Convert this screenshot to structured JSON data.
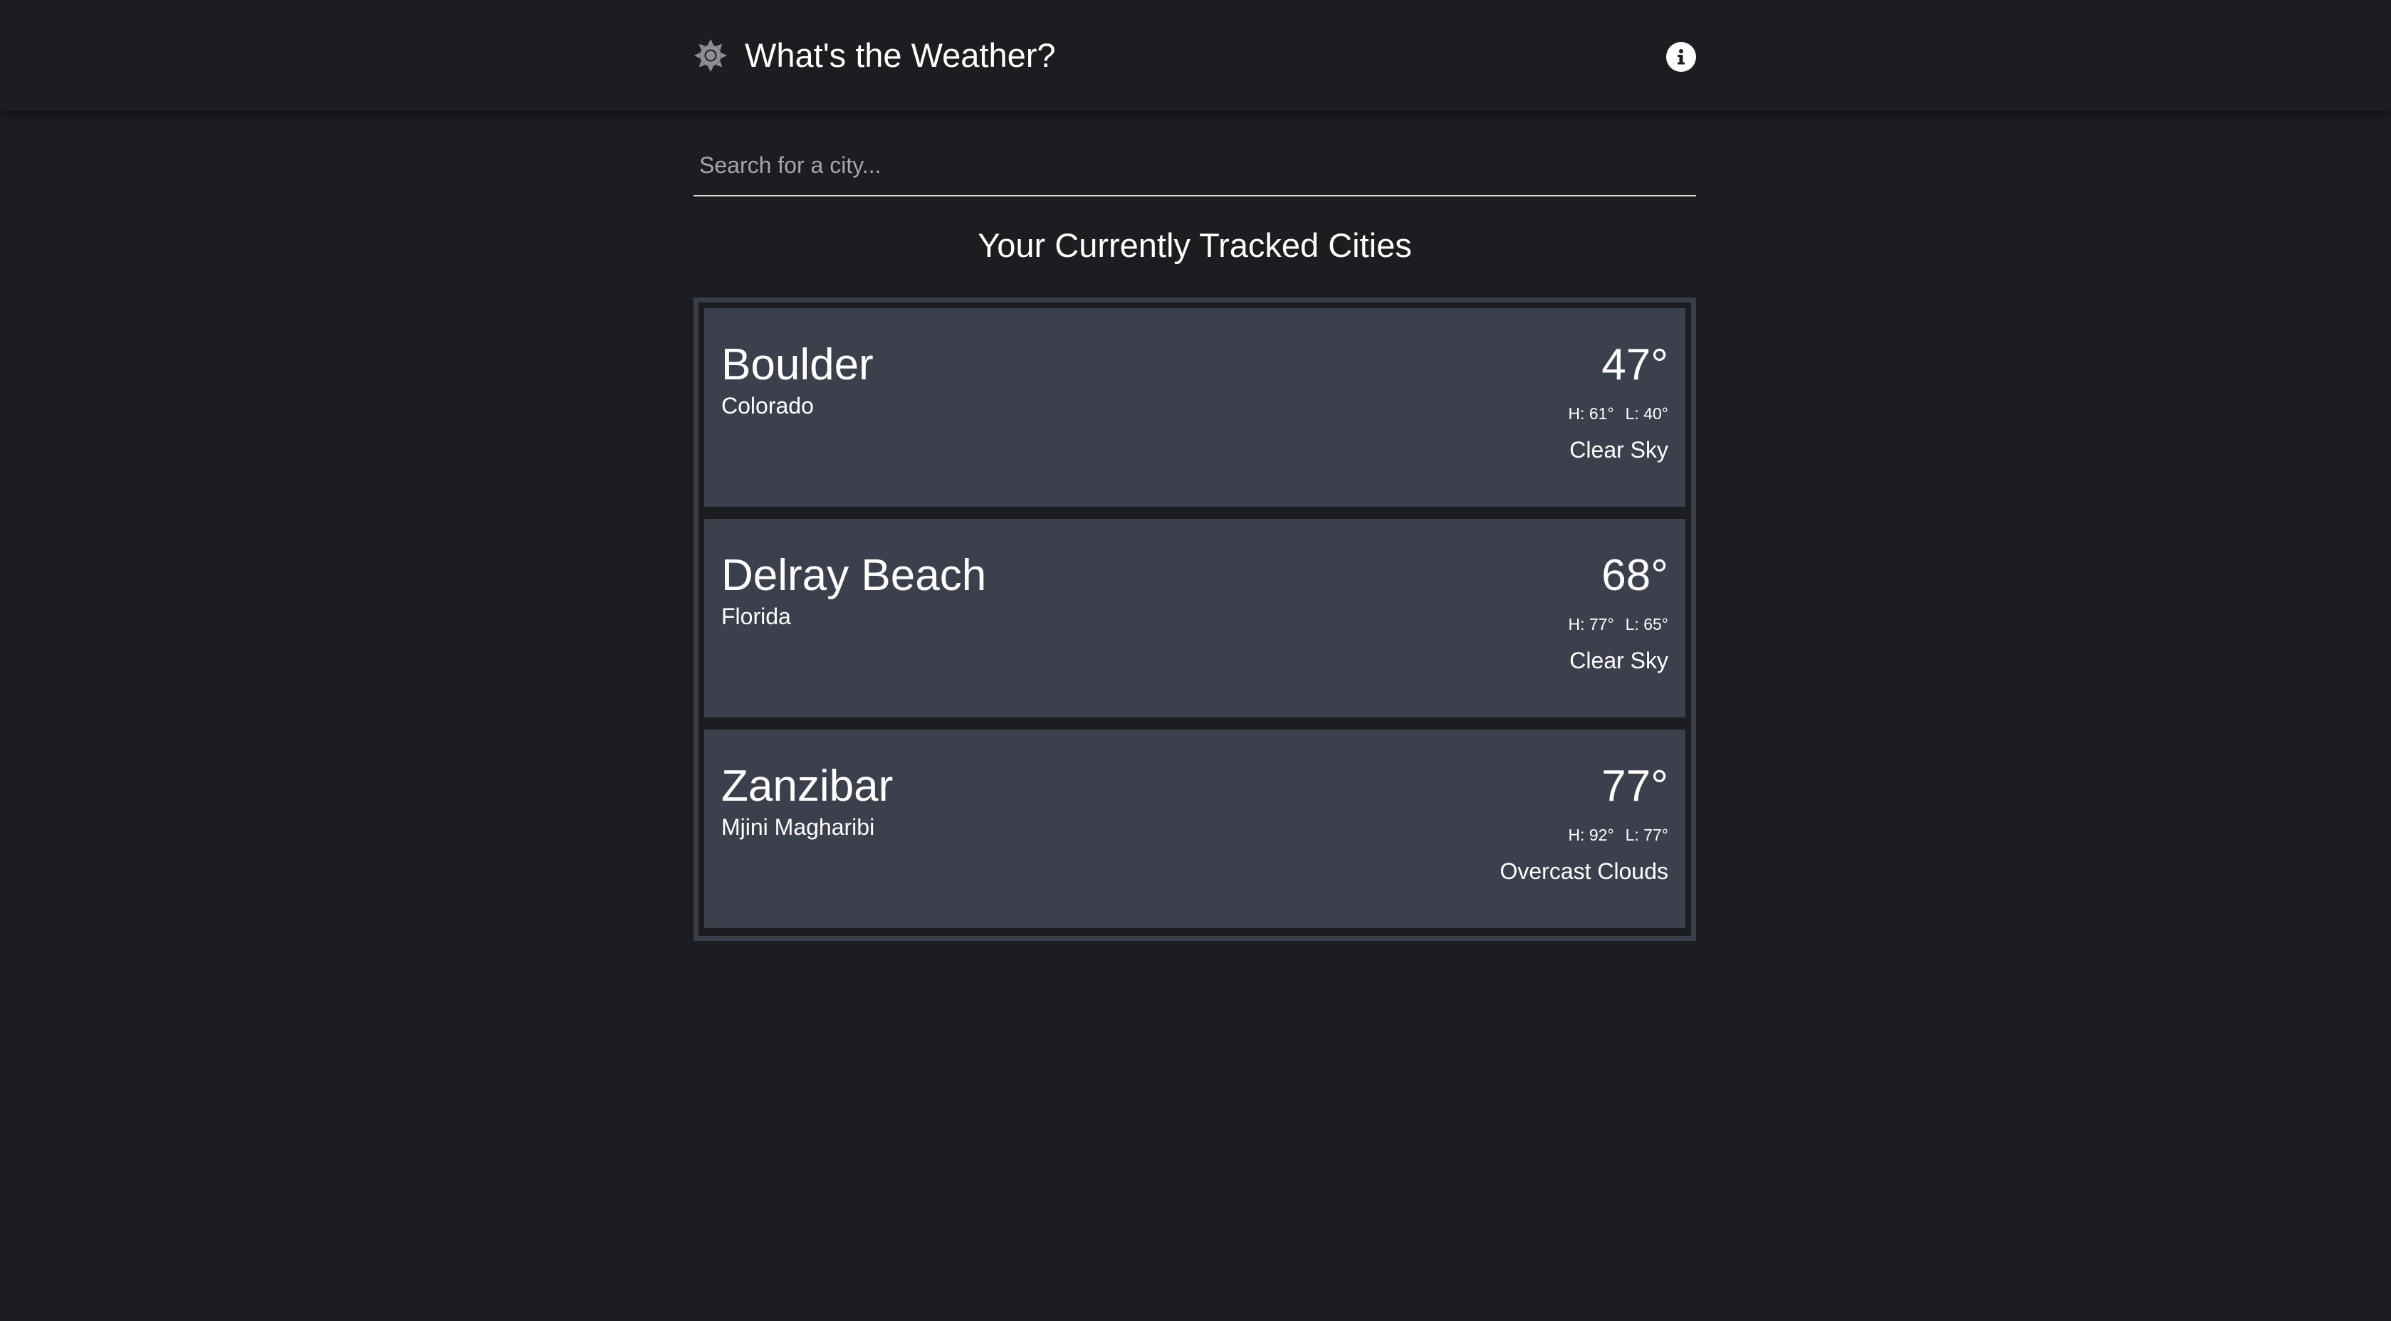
{
  "app": {
    "title": "What's the Weather?",
    "logo_icon": "sun-icon",
    "info_icon": "info-icon"
  },
  "search": {
    "placeholder": "Search for a city...",
    "value": ""
  },
  "section": {
    "title": "Your Currently Tracked Cities"
  },
  "cities": [
    {
      "name": "Boulder",
      "region": "Colorado",
      "temp": "47°",
      "high": "H: 61°",
      "low": "L: 40°",
      "condition": "Clear Sky"
    },
    {
      "name": "Delray Beach",
      "region": "Florida",
      "temp": "68°",
      "high": "H: 77°",
      "low": "L: 65°",
      "condition": "Clear Sky"
    },
    {
      "name": "Zanzibar",
      "region": "Mjini Magharibi",
      "temp": "77°",
      "high": "H: 92°",
      "low": "L: 77°",
      "condition": "Overcast Clouds"
    }
  ],
  "colors": {
    "background": "#1c1d21",
    "card": "#3c404c",
    "list_border": "#3a3e4a",
    "text": "#ffffff",
    "placeholder": "#a4a6ab",
    "sun_icon": "#8e8e92"
  }
}
